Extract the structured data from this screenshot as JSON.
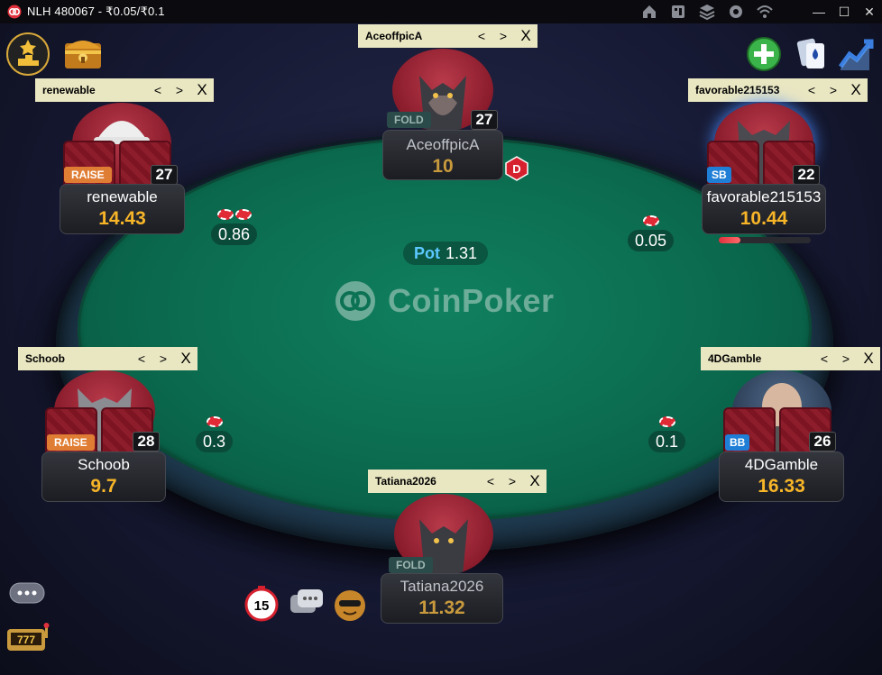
{
  "window": {
    "title": "NLH 480067 - ₹0.05/₹0.1",
    "controls": [
      "—",
      "☐",
      "✕"
    ],
    "toolbar_icons": [
      "home-icon",
      "cashier-icon",
      "layers-icon",
      "settings-icon",
      "wifi-icon"
    ]
  },
  "table": {
    "brand": "CoinPoker",
    "pot_label": "Pot",
    "pot_value": "1.31",
    "dealer_button": "D"
  },
  "seats": {
    "aceoffpica": {
      "note": "AceoffpicA",
      "name": "AceoffpicA",
      "stack": "10",
      "action": "FOLD",
      "count": "27"
    },
    "renewable": {
      "note": "renewable",
      "name": "renewable",
      "stack": "14.43",
      "action": "RAISE",
      "count": "27",
      "bet": "0.86"
    },
    "favorable": {
      "note": "favorable215153",
      "name": "favorable215153",
      "stack": "10.44",
      "position": "SB",
      "count": "22",
      "bet": "0.05"
    },
    "schoob": {
      "note": "Schoob",
      "name": "Schoob",
      "stack": "9.7",
      "action": "RAISE",
      "count": "28",
      "bet": "0.3"
    },
    "fourdgamble": {
      "note": "4DGamble",
      "name": "4DGamble",
      "stack": "16.33",
      "position": "BB",
      "count": "26",
      "bet": "0.1"
    },
    "tatiana": {
      "note": "Tatiana2026",
      "name": "Tatiana2026",
      "stack": "11.32",
      "action": "FOLD"
    }
  },
  "note_controls": {
    "prev": "<",
    "next": ">",
    "close": "X"
  },
  "bottom": {
    "timer": "15"
  }
}
